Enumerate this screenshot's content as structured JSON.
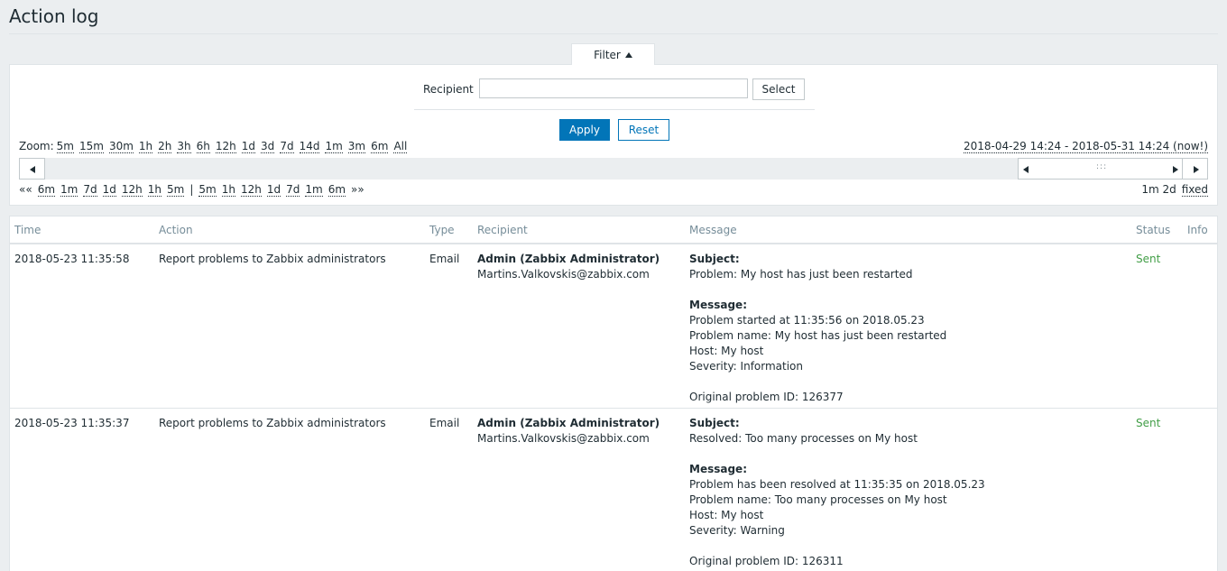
{
  "page": {
    "title": "Action log"
  },
  "filter": {
    "tab_label": "Filter",
    "recipient_label": "Recipient",
    "recipient_value": "",
    "select_label": "Select",
    "apply_label": "Apply",
    "reset_label": "Reset"
  },
  "timeline": {
    "zoom_label": "Zoom:",
    "zoom_options": [
      "5m",
      "15m",
      "30m",
      "1h",
      "2h",
      "3h",
      "6h",
      "12h",
      "1d",
      "3d",
      "7d",
      "14d",
      "1m",
      "3m",
      "6m",
      "All"
    ],
    "date_range": "2018-04-29 14:24 - 2018-05-31 14:24 (now!)",
    "nav_back_first": "««",
    "nav_back": [
      "6m",
      "1m",
      "7d",
      "1d",
      "12h",
      "1h",
      "5m"
    ],
    "nav_separator": "|",
    "nav_forward": [
      "5m",
      "1h",
      "12h",
      "1d",
      "7d",
      "1m",
      "6m"
    ],
    "nav_forward_last": "»»",
    "period": "1m 2d",
    "fixed": "fixed",
    "grip": ":::"
  },
  "table": {
    "headers": [
      "Time",
      "Action",
      "Type",
      "Recipient",
      "Message",
      "Status",
      "Info"
    ],
    "rows": [
      {
        "time": "2018-05-23 11:35:58",
        "action": "Report problems to Zabbix administrators",
        "type": "Email",
        "recipient_name": "Admin (Zabbix Administrator)",
        "recipient_email": "Martins.Valkovskis@zabbix.com",
        "subject_label": "Subject:",
        "subject": "Problem: My host has just been restarted",
        "message_label": "Message:",
        "message_lines": [
          "Problem started at 11:35:56 on 2018.05.23",
          "Problem name: My host has just been restarted",
          "Host: My host",
          "Severity: Information",
          "",
          "Original problem ID: 126377"
        ],
        "status": "Sent",
        "info": ""
      },
      {
        "time": "2018-05-23 11:35:37",
        "action": "Report problems to Zabbix administrators",
        "type": "Email",
        "recipient_name": "Admin (Zabbix Administrator)",
        "recipient_email": "Martins.Valkovskis@zabbix.com",
        "subject_label": "Subject:",
        "subject": "Resolved: Too many processes on My host",
        "message_label": "Message:",
        "message_lines": [
          "Problem has been resolved at 11:35:35 on 2018.05.23",
          "Problem name: Too many processes on My host",
          "Host: My host",
          "Severity: Warning",
          "",
          "Original problem ID: 126311"
        ],
        "status": "Sent",
        "info": ""
      }
    ]
  },
  "colors": {
    "primary": "#0275b8",
    "sent": "#429e47",
    "background": "#ebeef0"
  }
}
